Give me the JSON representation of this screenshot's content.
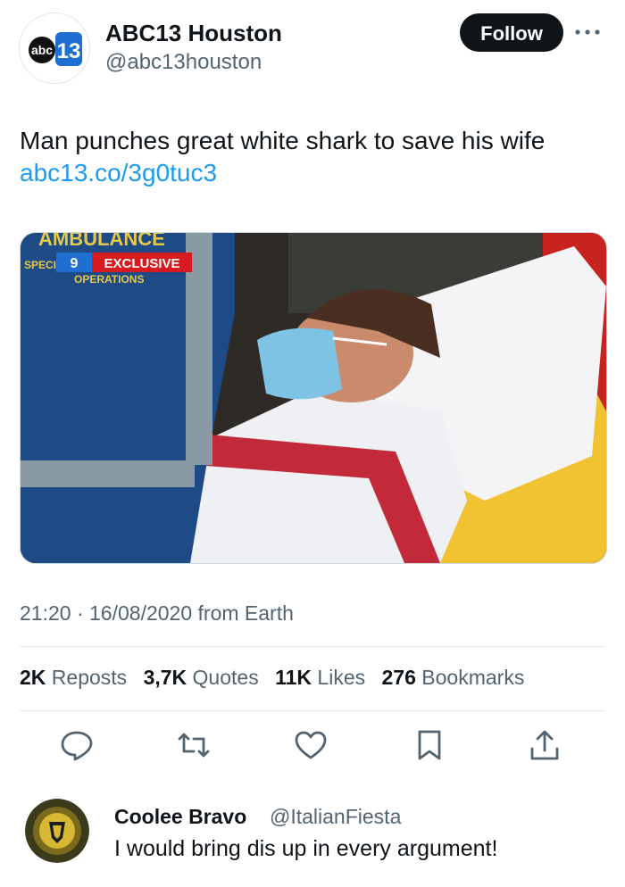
{
  "author": {
    "name": "ABC13 Houston",
    "handle": "@abc13houston",
    "logo_text_abc": "abc",
    "logo_text_num": "13"
  },
  "follow_label": "Follow",
  "tweet": {
    "text": "Man punches great white shark to save his wife",
    "link": "abc13.co/3g0tuc3"
  },
  "media": {
    "top_banner_text": "AMBULANCE",
    "badge_text": "EXCLUSIVE",
    "side_text": "SPECIAL",
    "sub_text": "OPERATIONS"
  },
  "meta": {
    "time": "21:20",
    "separator": "·",
    "date": "16/08/2020",
    "source": "from Earth"
  },
  "stats": [
    {
      "count": "2K",
      "label": "Reposts"
    },
    {
      "count": "3,7K",
      "label": "Quotes"
    },
    {
      "count": "11K",
      "label": "Likes"
    },
    {
      "count": "276",
      "label": "Bookmarks"
    }
  ],
  "actions": [
    "reply-icon",
    "repost-icon",
    "like-icon",
    "bookmark-icon",
    "share-icon"
  ],
  "reply": {
    "name": "Coolee Bravo",
    "handle": "@ItalianFiesta",
    "text": "I would bring dis up in every argument!"
  },
  "colors": {
    "link": "#1d9bf0",
    "muted": "#536471",
    "abc_blue": "#1f6fd1",
    "badge_red": "#d71920"
  }
}
